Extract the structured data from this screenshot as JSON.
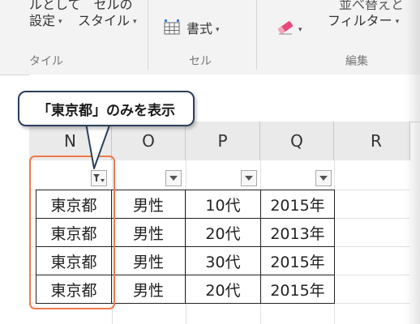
{
  "ribbon": {
    "styles_group": {
      "line1_text": "ルとして　セルの",
      "conditional_format_label": "設定",
      "cell_styles_label": "スタイル",
      "caption_fragment": "タイル"
    },
    "cells_group": {
      "format_label": "書式",
      "caption": "セル"
    },
    "editing_group": {
      "sort_line1": "並べ替えと",
      "sort_line2": "フィルター",
      "caption": "編集"
    }
  },
  "callout": {
    "text": "「東京都」のみを表示"
  },
  "columns": [
    "N",
    "O",
    "P",
    "Q",
    "R"
  ],
  "rows": [
    [
      "東京都",
      "男性",
      "10代",
      "2015年"
    ],
    [
      "東京都",
      "男性",
      "20代",
      "2013年"
    ],
    [
      "東京都",
      "男性",
      "30代",
      "2015年"
    ],
    [
      "東京都",
      "男性",
      "20代",
      "2015年"
    ]
  ],
  "colors": {
    "highlight": "#ee7a4a",
    "callout_border": "#2b3f5c",
    "eraser": "#e8487a"
  }
}
